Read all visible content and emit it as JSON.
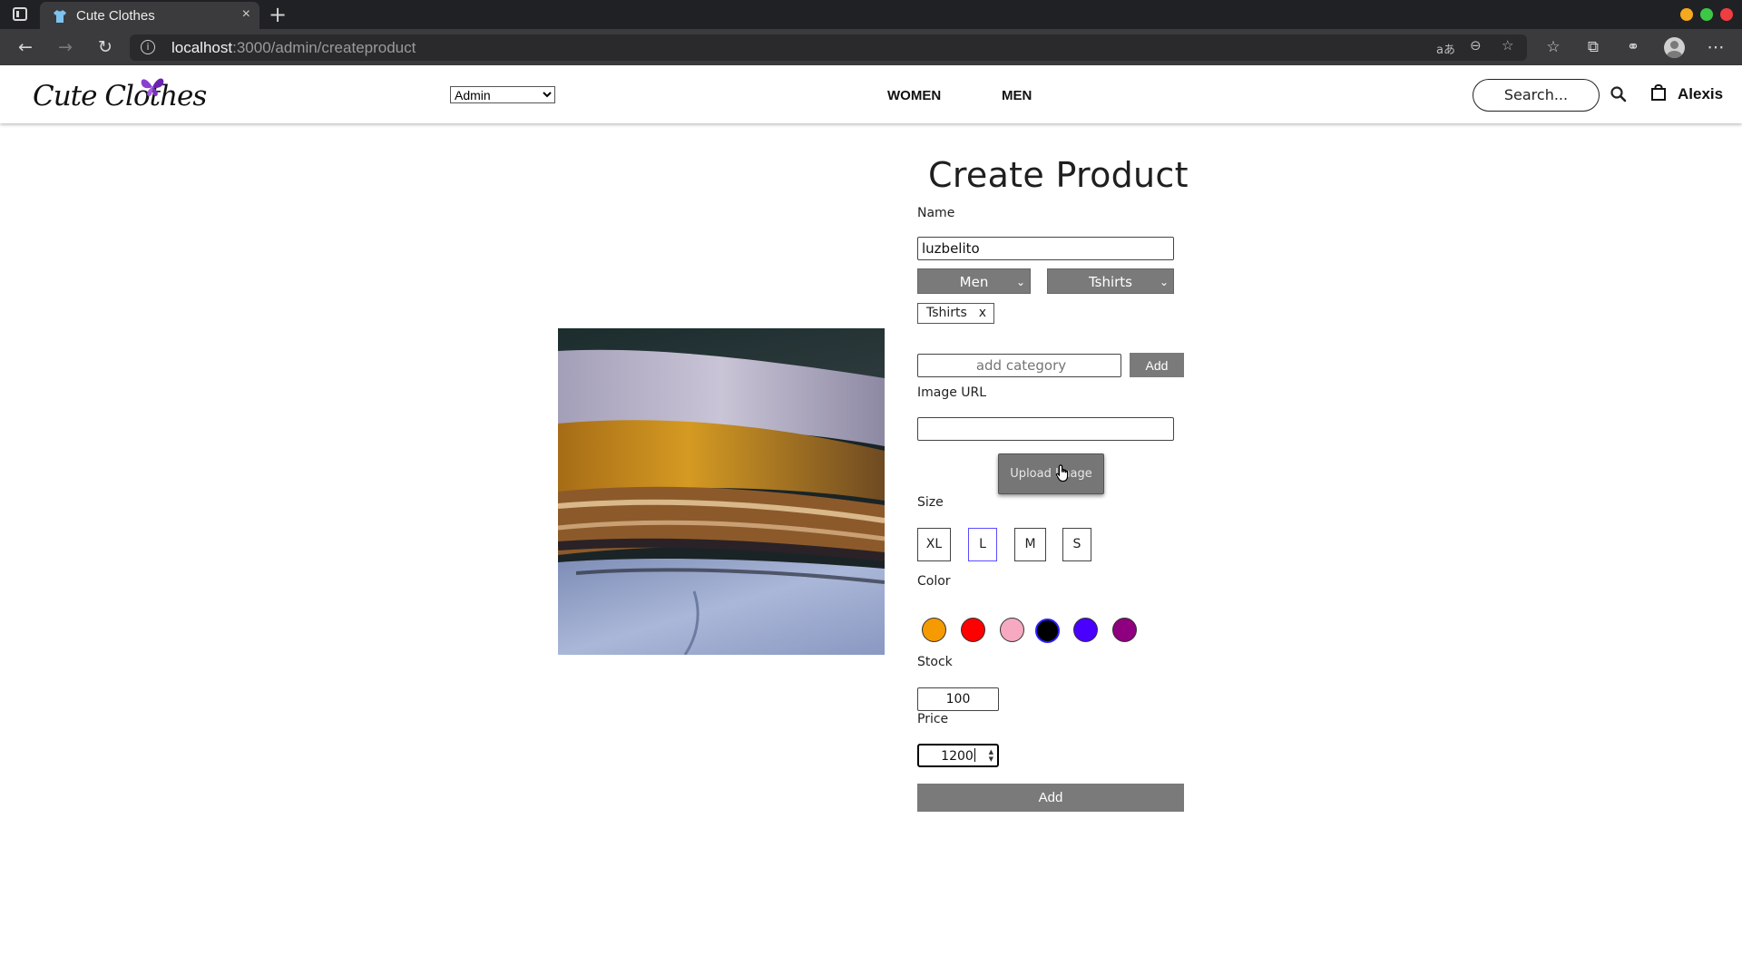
{
  "browser": {
    "tab_title": "Cute Clothes",
    "tab_close": "×",
    "new_tab": "+",
    "url_host": "localhost",
    "url_path": ":3000/admin/createproduct"
  },
  "header": {
    "logo_text": "Cute Clothes",
    "role_select": "Admin",
    "nav": [
      "WOMEN",
      "MEN"
    ],
    "search_placeholder": "Search...",
    "user_name": "Alexis"
  },
  "form": {
    "title": "Create Product",
    "name_label": "Name",
    "name_value": "luzbelito",
    "gender_select": "Men",
    "category_select": "Tshirts",
    "selected_category_chip": "Tshirts",
    "chip_remove": "x",
    "add_category_placeholder": "add category",
    "add_category_button": "Add",
    "image_url_label": "Image URL",
    "image_url_value": "",
    "upload_button": "Upload Image",
    "size_label": "Size",
    "sizes": [
      "XL",
      "L",
      "M",
      "S"
    ],
    "selected_size": "L",
    "color_label": "Color",
    "colors": [
      "#f59a00",
      "#ff0000",
      "#f6a9c0",
      "#000000",
      "#4a00ff",
      "#8e0080"
    ],
    "selected_color": "#000000",
    "stock_label": "Stock",
    "stock_value": "100",
    "price_label": "Price",
    "price_value": "1200",
    "submit_button": "Add"
  },
  "colors": {
    "chrome_dark": "#202124",
    "chrome_toolbar": "#3b3b3d",
    "button_gray": "#7a7a7a",
    "logo_purple": "#7b2fbe"
  }
}
